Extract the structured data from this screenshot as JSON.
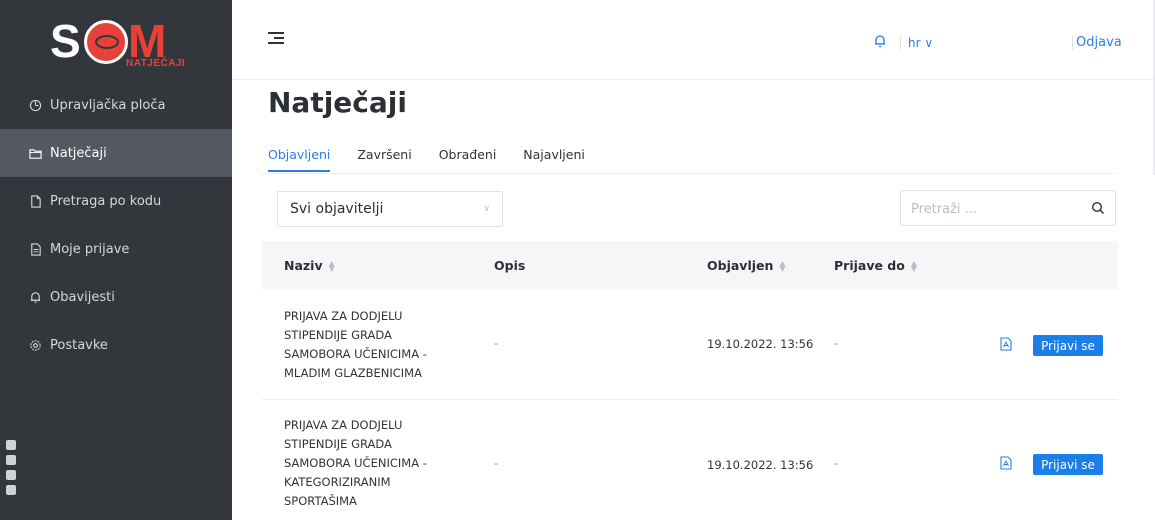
{
  "brand": {
    "logo_sub": "NATJEČAJI",
    "colors": {
      "accent": "#e8413a",
      "sidebar": "#33373c",
      "sidebar_active": "#545960",
      "link": "#2b7de9",
      "button": "#1a7fe8"
    }
  },
  "sidebar": {
    "items": [
      {
        "label": "Upravljačka ploča",
        "icon": "dashboard-icon"
      },
      {
        "label": "Natječaji",
        "icon": "folder-icon",
        "active": true
      },
      {
        "label": "Pretraga po kodu",
        "icon": "document-icon"
      },
      {
        "label": "Moje prijave",
        "icon": "document-icon"
      },
      {
        "label": "Obavijesti",
        "icon": "bell-icon"
      },
      {
        "label": "Postavke",
        "icon": "gear-icon"
      }
    ]
  },
  "topbar": {
    "language": "hr ∨",
    "logout": "Odjava"
  },
  "main": {
    "title": "Natječaji",
    "tabs": [
      {
        "label": "Objavljeni",
        "active": true
      },
      {
        "label": "Završeni"
      },
      {
        "label": "Obrađeni"
      },
      {
        "label": "Najavljeni"
      }
    ],
    "filter": {
      "selected": "Svi objavitelji"
    },
    "search": {
      "placeholder": "Pretraži ..."
    },
    "table": {
      "headers": {
        "name": "Naziv",
        "desc": "Opis",
        "published": "Objavljen",
        "deadline": "Prijave do"
      },
      "rows": [
        {
          "name_lines": [
            "PRIJAVA ZA DODJELU",
            "STIPENDIJE GRADA",
            "SAMOBORA UČENICIMA -",
            "MLADIM GLAZBENICIMA"
          ],
          "desc": "-",
          "published": "19.10.2022. 13:56",
          "deadline": "-",
          "action": "Prijavi se"
        },
        {
          "name_lines": [
            "PRIJAVA ZA DODJELU",
            "STIPENDIJE GRADA",
            "SAMOBORA UČENICIMA -",
            "KATEGORIZIRANIM",
            "SPORTAŠIMA"
          ],
          "desc": "-",
          "published": "19.10.2022. 13:56",
          "deadline": "-",
          "action": "Prijavi se"
        }
      ]
    }
  }
}
